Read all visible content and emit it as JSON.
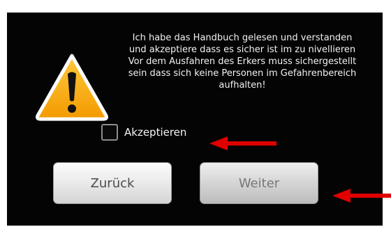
{
  "dialog": {
    "message": "Ich habe das Handbuch gelesen und verstanden\nund akzeptiere dass es sicher ist im zu nivellieren\nVor dem Ausfahren des Erkers muss sichergestellt\nsein dass sich keine Personen im Gefahrenbereich\naufhalten!",
    "checkbox_label": "Akzeptieren",
    "checkbox_checked": false,
    "icon": "warning-triangle",
    "background": "#040404",
    "icon_color": "#f5a300"
  },
  "buttons": {
    "back_label": "Zurück",
    "next_label": "Weiter",
    "next_enabled": false
  },
  "annotations": {
    "arrow_color": "#e00000",
    "arrows": [
      "pointer-to-checkbox",
      "pointer-to-next-button"
    ]
  }
}
